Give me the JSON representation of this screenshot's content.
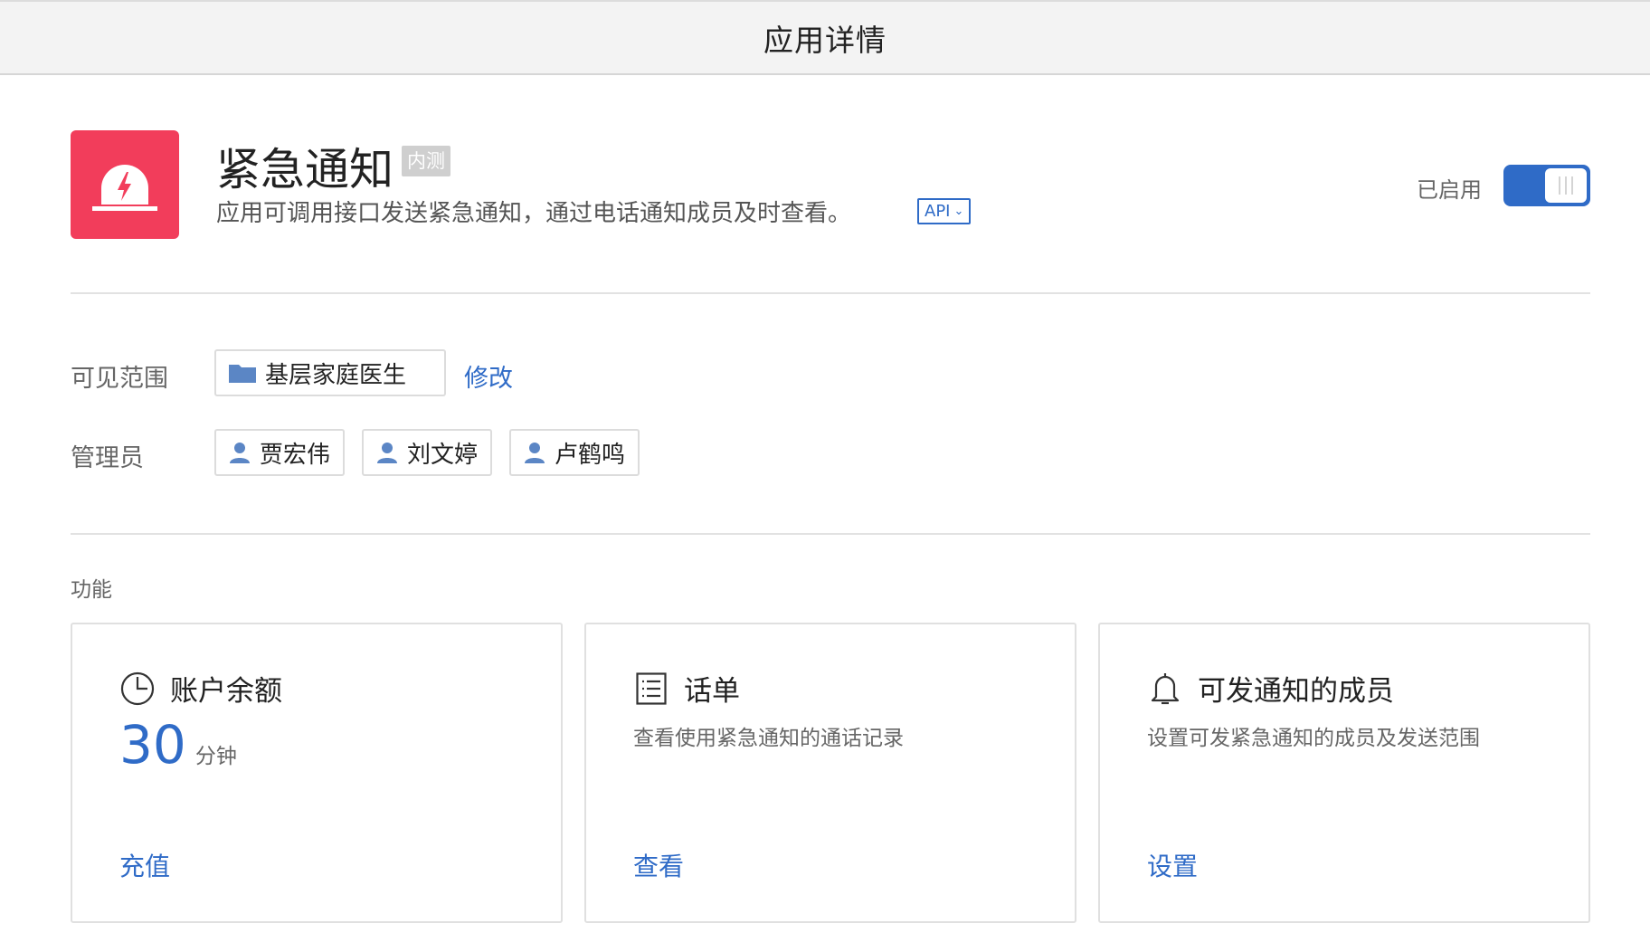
{
  "window": {
    "title": "应用详情"
  },
  "app": {
    "name": "紧急通知",
    "badge": "内测",
    "description": "应用可调用接口发送紧急通知，通过电话通知成员及时查看。",
    "api_tag": "API",
    "status_label": "已启用",
    "enabled": true,
    "icon_color": "#f23d5b",
    "icon": "emergency-light-icon"
  },
  "visibility": {
    "label": "可见范围",
    "scope": "基层家庭医生",
    "edit_link": "修改"
  },
  "admins": {
    "label": "管理员",
    "items": [
      "贾宏伟",
      "刘文婷",
      "卢鹤鸣"
    ]
  },
  "features": {
    "label": "功能",
    "cards": [
      {
        "icon": "clock-icon",
        "title": "账户余额",
        "balance": "30",
        "unit": "分钟",
        "action": "充值"
      },
      {
        "icon": "list-icon",
        "title": "话单",
        "desc": "查看使用紧急通知的通话记录",
        "action": "查看"
      },
      {
        "icon": "bell-icon",
        "title": "可发通知的成员",
        "desc": "设置可发紧急通知的成员及发送范围",
        "action": "设置"
      }
    ]
  },
  "colors": {
    "accent": "#2f6bc7",
    "text": "#222222",
    "muted": "#666666"
  }
}
